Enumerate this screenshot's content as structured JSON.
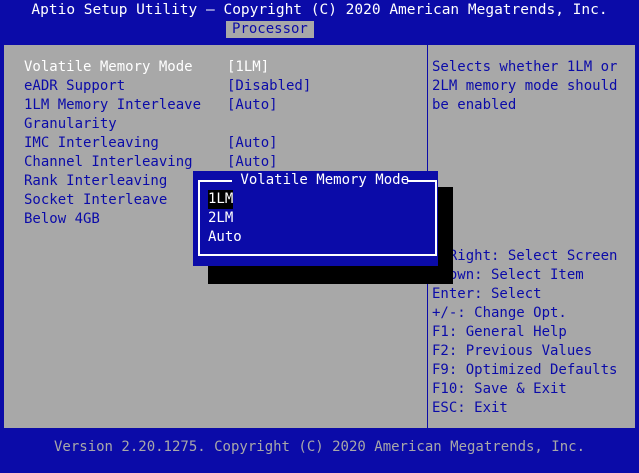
{
  "header": {
    "title": "Aptio Setup Utility – Copyright (C) 2020 American Megatrends, Inc.",
    "active_tab": "Processor"
  },
  "settings": [
    {
      "label": "Volatile Memory Mode",
      "value": "[1LM]"
    },
    {
      "label": "eADR Support",
      "value": "[Disabled]"
    },
    {
      "label": "1LM Memory Interleave",
      "value": "[Auto]"
    },
    {
      "label": "Granularity",
      "value": ""
    },
    {
      "label": "IMC Interleaving",
      "value": "[Auto]"
    },
    {
      "label": "Channel Interleaving",
      "value": "[Auto]"
    },
    {
      "label": "Rank Interleaving",
      "value": ""
    },
    {
      "label": "Socket Interleave",
      "value": ""
    },
    {
      "label": "Below 4GB",
      "value": ""
    }
  ],
  "help": {
    "description": [
      "Selects whether 1LM or",
      "2LM memory mode should",
      "be enabled"
    ],
    "keys": [
      "t/Right: Select Screen",
      " Down: Select Item",
      "Enter: Select",
      "+/-: Change Opt.",
      "F1: General Help",
      "F2: Previous Values",
      "F9: Optimized Defaults",
      "F10: Save & Exit",
      "ESC: Exit"
    ]
  },
  "popup": {
    "title": " Volatile Memory Mode ",
    "options": [
      "1LM",
      "2LM",
      "Auto"
    ],
    "selected": "1LM"
  },
  "footer": {
    "version": "Version 2.20.1275. Copyright (C) 2020 American Megatrends, Inc."
  },
  "colors": {
    "background": "#0b0ba8",
    "panel": "#a8a8a8",
    "highlight_text": "#ffffff",
    "shadow": "#000000"
  }
}
